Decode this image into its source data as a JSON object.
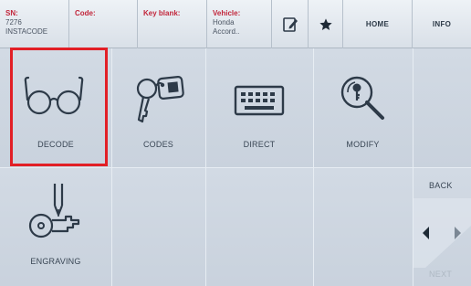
{
  "header": {
    "sn": {
      "label": "SN:",
      "line1": "7276",
      "line2": "INSTACODE"
    },
    "code": {
      "label": "Code:"
    },
    "key_blank": {
      "label": "Key blank:"
    },
    "vehicle": {
      "label": "Vehicle:",
      "line1": "Honda",
      "line2": "Accord.."
    },
    "notes_icon": "notepad-pen-icon",
    "favorite_icon": "star-icon",
    "home_label": "HOME",
    "info_label": "INFO"
  },
  "tiles": {
    "decode": {
      "label": "DECODE",
      "icon": "glasses-icon"
    },
    "codes": {
      "label": "CODES",
      "icon": "key-tag-icon"
    },
    "direct": {
      "label": "DIRECT",
      "icon": "keyboard-icon"
    },
    "modify": {
      "label": "MODIFY",
      "icon": "magnifier-key-icon"
    },
    "engraving": {
      "label": "ENGRAVING",
      "icon": "engraving-key-icon"
    }
  },
  "nav": {
    "back_label": "BACK",
    "next_label": "NEXT",
    "prev_icon": "triangle-left-icon",
    "next_icon": "triangle-right-icon"
  },
  "colors": {
    "accent": "#e21f26",
    "label_red": "#c2263b",
    "tile_bg": "#cdd5df"
  }
}
